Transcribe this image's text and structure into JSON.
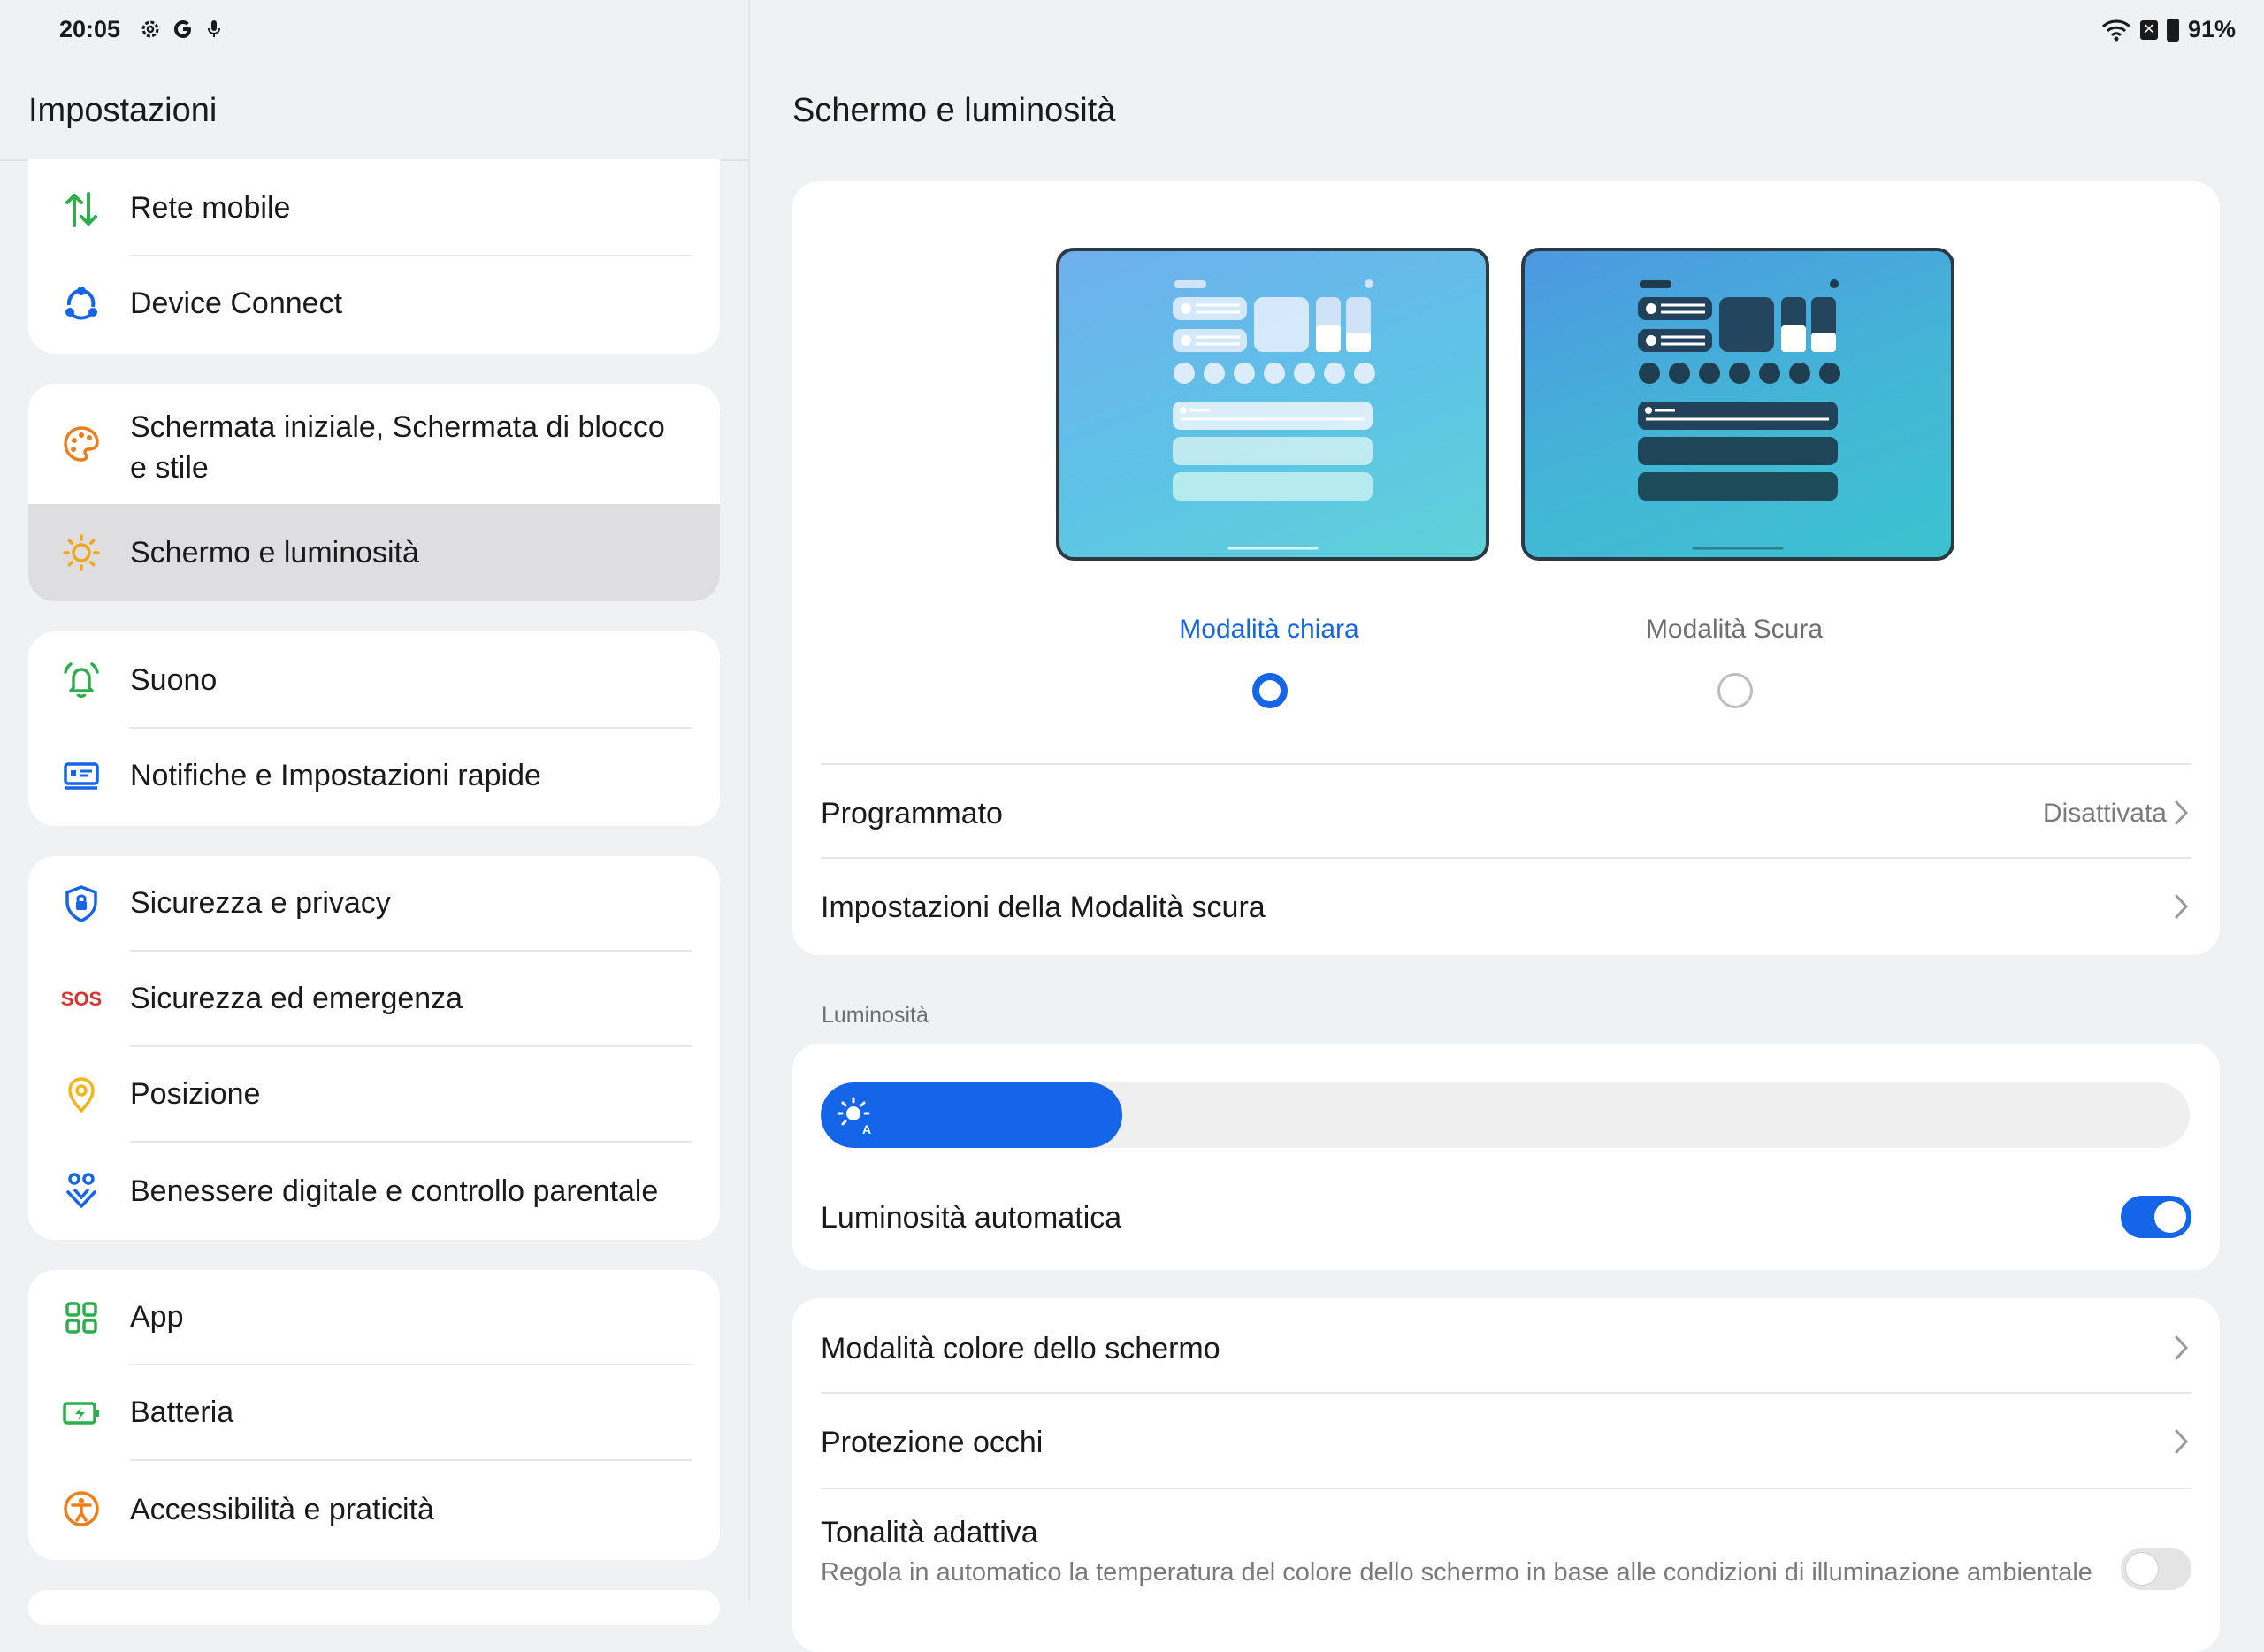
{
  "status_bar": {
    "time": "20:05",
    "left_icons": [
      "gear-icon",
      "google-icon",
      "mic-icon"
    ],
    "battery": "91%"
  },
  "sidebar": {
    "title": "Impostazioni",
    "groups": [
      {
        "items": [
          {
            "label": "Rete mobile",
            "icon": "mobile-data-icon"
          },
          {
            "label": "Device Connect",
            "icon": "device-connect-icon"
          }
        ]
      },
      {
        "items": [
          {
            "label_line1": "Schermata iniziale, Schermata di blocco",
            "label_line2": "e stile",
            "icon": "palette-icon"
          },
          {
            "label": "Schermo e luminosità",
            "icon": "sun-icon",
            "selected": true
          }
        ]
      },
      {
        "items": [
          {
            "label": "Suono",
            "icon": "bell-icon"
          },
          {
            "label": "Notifiche e Impostazioni rapide",
            "icon": "notification-icon"
          }
        ]
      },
      {
        "items": [
          {
            "label": "Sicurezza e privacy",
            "icon": "shield-icon"
          },
          {
            "label": "Sicurezza ed emergenza",
            "icon": "sos-icon",
            "icon_text": "SOS"
          },
          {
            "label": "Posizione",
            "icon": "location-icon"
          },
          {
            "label": "Benessere digitale e controllo parentale",
            "icon": "wellbeing-icon"
          }
        ]
      },
      {
        "items": [
          {
            "label": "App",
            "icon": "apps-grid-icon"
          },
          {
            "label": "Batteria",
            "icon": "battery-icon"
          },
          {
            "label": "Accessibilità e praticità",
            "icon": "accessibility-icon"
          }
        ]
      }
    ]
  },
  "main": {
    "title": "Schermo e luminosità",
    "modes": {
      "light_label": "Modalità chiara",
      "dark_label": "Modalità Scura",
      "selected": "light"
    },
    "scheduled": {
      "label": "Programmato",
      "value": "Disattivata"
    },
    "dark_settings": {
      "label": "Impostazioni della Modalità scura"
    },
    "brightness_section": "Luminosità",
    "brightness": {
      "level_fraction": 0.22,
      "auto_label": "Luminosità automatica",
      "auto_on": true
    },
    "color_mode": {
      "label": "Modalità colore dello schermo"
    },
    "eye_protection": {
      "label": "Protezione occhi"
    },
    "adaptive_tone": {
      "label": "Tonalità adattiva",
      "description": "Regola in automatico la temperatura del colore dello schermo in base alle condizioni di illuminazione ambientale",
      "on": false
    },
    "colors": {
      "accent": "#1565e8",
      "light_mode_label_color": "#1565e8",
      "sos_color": "#d9362f"
    }
  }
}
